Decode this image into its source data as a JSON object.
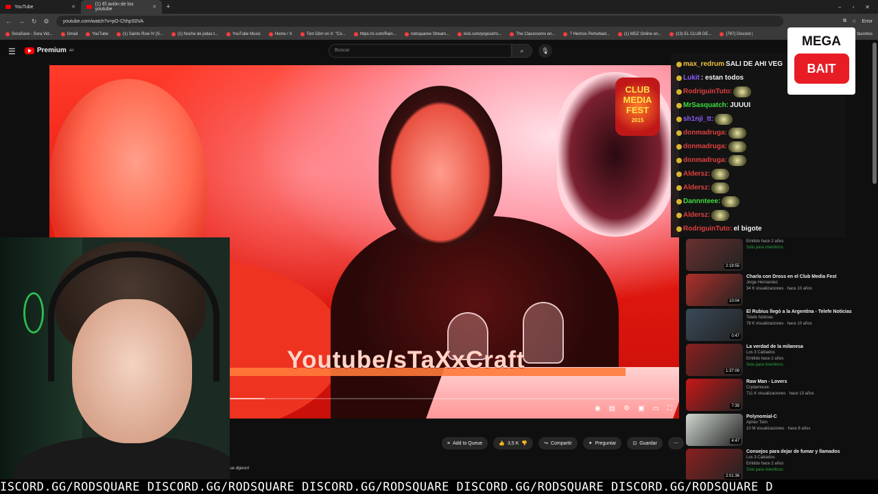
{
  "browser": {
    "tabs": [
      {
        "label": "YouTube",
        "active": false
      },
      {
        "label": "(1) El avión de los youtube",
        "active": true
      }
    ],
    "new_tab": "+",
    "window_controls": [
      "−",
      "▫",
      "✕"
    ],
    "url": "youtube.com/watch?v=pO-ChhpS0VA",
    "profile_label": "Error",
    "bookmarks": [
      "SoraSave - Sora Vid...",
      "Gmail",
      "YouTube",
      "(1) Saints Row IV [S...",
      "(1) Noche de jodas t...",
      "YouTube Music",
      "Home / X",
      "Tom Dörr on X: \"Co...",
      "https://x.com/Rain...",
      "rodsquaree Stream...",
      "kick.com/popout/ro...",
      "The Classrooms en...",
      "7 Hechos Perturbad...",
      "(1) MDZ Online on...",
      "(13) EL CLUB DE...",
      "(787) Discord |"
    ],
    "bookmarks_end": "favoritos"
  },
  "youtube": {
    "logo": "Premium",
    "logo_region": "AR",
    "search_placeholder": "Buscar"
  },
  "video": {
    "watermark": "Youtube/sTaXxCraft",
    "overlay_badge_line1": "CLUB",
    "overlay_badge_line2": "MEDIA",
    "overlay_badge_line3": "FEST",
    "overlay_badge_year": "2015",
    "progress": 0.34
  },
  "actions": {
    "queue": "Add to Queue",
    "likes": "3,5 K",
    "share": "Compartir",
    "ask": "Preguntar",
    "save": "Guardar"
  },
  "caption_fragment": "que dijeron!",
  "chat": [
    {
      "user": "max_redrum",
      "color": "#f0c040",
      "text": "SALI DE AHI VEG"
    },
    {
      "user": "Lukit",
      "color": "#8a5cff",
      "text": ": estan todos"
    },
    {
      "user": "RodriguinTuto:",
      "color": "#e04040",
      "text": ""
    },
    {
      "user": "MrSasquatch:",
      "color": "#3fdc3f",
      "text": "JUUUI"
    },
    {
      "user": "sh1nji_tt:",
      "color": "#8a5cff",
      "text": ""
    },
    {
      "user": "donmadruga:",
      "color": "#e04040",
      "text": ""
    },
    {
      "user": "donmadruga:",
      "color": "#e04040",
      "text": ""
    },
    {
      "user": "donmadruga:",
      "color": "#e04040",
      "text": ""
    },
    {
      "user": "Aldersz:",
      "color": "#e04040",
      "text": ""
    },
    {
      "user": "Aldersz:",
      "color": "#e04040",
      "text": ""
    },
    {
      "user": "Dannnteee:",
      "color": "#3fdc3f",
      "text": ""
    },
    {
      "user": "Aldersz:",
      "color": "#e04040",
      "text": ""
    },
    {
      "user": "RodriguinTuto:",
      "color": "#e04040",
      "text": "el bigote"
    }
  ],
  "mega_bait": {
    "line1": "MEGA",
    "line2": "BAIT"
  },
  "recommendations": [
    {
      "title": "",
      "channel": "Emitido hace 2 años",
      "meta": "",
      "members": "Solo para miembros",
      "duration": "2:19:55",
      "thumb_color": "#6a3030"
    },
    {
      "title": "Charla con Dross en el Club Media Fest",
      "channel": "Jorge Hernandez",
      "meta": "34 K visualizaciones · hace 10 años",
      "members": "",
      "duration": "10:04",
      "thumb_color": "#b0302a"
    },
    {
      "title": "El Rubius llegó a la Argentina - Telefe Noticias",
      "channel": "Telefe Noticias",
      "meta": "78 K visualizaciones · hace 10 años",
      "members": "",
      "duration": "0:47",
      "thumb_color": "#3a4a5a"
    },
    {
      "title": "La verdad de la milanesa",
      "channel": "Los 3 Cabiados",
      "meta": "Emitido hace 2 años",
      "members": "Solo para miembros",
      "duration": "1:37:09",
      "thumb_color": "#8a2020"
    },
    {
      "title": "Raw Man - Lovers",
      "channel": "Crydamoure",
      "meta": "711 K visualizaciones · hace 13 años",
      "members": "",
      "duration": "7:39",
      "thumb_color": "#c81818"
    },
    {
      "title": "Polynomial-C",
      "channel": "Aphex Twin",
      "meta": "10 M visualizaciones · hace 8 años",
      "members": "",
      "duration": "4:47",
      "thumb_color": "#cfd8d0"
    },
    {
      "title": "Consejos para dejar de fumar y llamados",
      "channel": "Los 3 Cabiados",
      "meta": "Emitido hace 2 años",
      "members": "Solo para miembros",
      "duration": "2:01:36",
      "thumb_color": "#8a2020"
    }
  ],
  "ticker": "ISCORD.GG/RODSQUARE DISCORD.GG/RODSQUARE DISCORD.GG/RODSQUARE DISCORD.GG/RODSQUARE DISCORD.GG/RODSQUARE D"
}
